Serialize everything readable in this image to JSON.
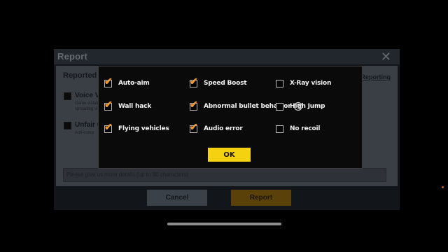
{
  "report_panel": {
    "title": "Report",
    "close_glyph": "✕",
    "reported_label": "Reported Pl",
    "ban_link": "t Reporting",
    "categories": [
      {
        "label": "Voice Vic",
        "desc_lines": [
          "Game violati",
          "spreading vi"
        ]
      },
      {
        "label": "Unfair C",
        "desc_lines": [
          "Anti-comp"
        ]
      }
    ],
    "detail_placeholder": "Please give us more details (up to 80 characters)",
    "cancel_label": "Cancel",
    "report_label": "Report"
  },
  "modal": {
    "options": [
      {
        "label": "Auto-aim",
        "checked": true
      },
      {
        "label": "Speed Boost",
        "checked": true
      },
      {
        "label": "X-Ray vision",
        "checked": false
      },
      {
        "label": "Wall hack",
        "checked": true
      },
      {
        "label": "Abnormal bullet behavior",
        "checked": true,
        "help": true
      },
      {
        "label": "High Jump",
        "checked": false
      },
      {
        "label": "Flying vehicles",
        "checked": true
      },
      {
        "label": "Audio error",
        "checked": true
      },
      {
        "label": "No recoil",
        "checked": false
      }
    ],
    "check_glyph": "✔",
    "help_glyph": "?",
    "ok_label": "OK"
  },
  "colors": {
    "accent_check": "#f29a2e",
    "ok_button": "#f5d211",
    "report_button": "#8a6410"
  }
}
